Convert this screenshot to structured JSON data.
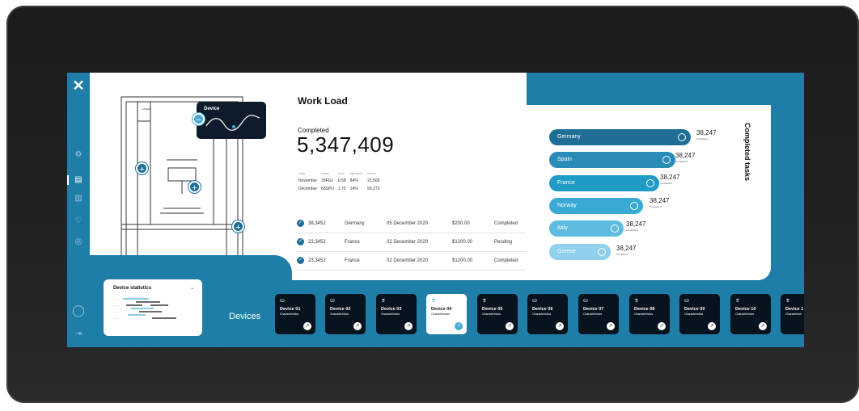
{
  "brand": {
    "logo_glyph": "✕"
  },
  "sidebar": {
    "icons": [
      "gear-icon",
      "layout-icon",
      "chart-icon",
      "heart-icon",
      "pin-icon"
    ],
    "bottom_icons": [
      "fingerprint-icon",
      "logout-icon"
    ]
  },
  "device_popup": {
    "label": "Device"
  },
  "workload": {
    "title": "Work Load",
    "completed_label": "Completed",
    "completed_value": "5,347,409",
    "mini_table": {
      "headers": [
        "TIME",
        "CODE",
        "UNIT",
        "PERCENT",
        "TOTAL"
      ],
      "rows": [
        [
          "November",
          "39FGI",
          "0.58",
          "84%",
          "21,568"
        ],
        [
          "December",
          "68SPU",
          "1.70",
          "14%",
          "56,273"
        ]
      ]
    },
    "rows": [
      {
        "id": "38,3452",
        "country": "Germany",
        "date": "05 December 2020",
        "amount": "$200.00",
        "status": "Completed"
      },
      {
        "id": "23,3452",
        "country": "France",
        "date": "02 December 2020",
        "amount": "$1200.00",
        "status": "Pending"
      },
      {
        "id": "23,3452",
        "country": "France",
        "date": "02 December 2020",
        "amount": "$1200.00",
        "status": "Completed"
      }
    ]
  },
  "completed_tasks": {
    "title": "Completed tasks",
    "bars": [
      {
        "country": "Germany",
        "value": "38,247",
        "sub": "Completed",
        "color": "#1f6e96"
      },
      {
        "country": "Spain",
        "value": "38,247",
        "sub": "Completed",
        "color": "#2a8bb8"
      },
      {
        "country": "France",
        "value": "38,247",
        "sub": "Completed",
        "color": "#1f9cc6"
      },
      {
        "country": "Norway",
        "value": "38,247",
        "sub": "Completed",
        "color": "#39aad3"
      },
      {
        "country": "Italy",
        "value": "38,247",
        "sub": "Completed",
        "color": "#5ebbe0"
      },
      {
        "country": "Greece",
        "value": "38,247",
        "sub": "Completed",
        "color": "#8fd0ec"
      }
    ]
  },
  "stats_card": {
    "title": "Device statistics"
  },
  "devices": {
    "label": "Devices",
    "items": [
      {
        "name": "Device 01",
        "sub": "Characteristics",
        "icon": "⛀",
        "active": false
      },
      {
        "name": "Device 02",
        "sub": "Characteristics",
        "icon": "⛀",
        "active": false
      },
      {
        "name": "Device 03",
        "sub": "Characteristics",
        "icon": "⌆",
        "active": false
      },
      {
        "name": "Device 04",
        "sub": "Characteristics",
        "icon": "⌆",
        "active": true
      },
      {
        "name": "Device 05",
        "sub": "Characteristics",
        "icon": "⌆",
        "active": false
      },
      {
        "name": "Device 06",
        "sub": "Characteristics",
        "icon": "⛀",
        "active": false
      },
      {
        "name": "Device 07",
        "sub": "Characteristics",
        "icon": "⛀",
        "active": false
      },
      {
        "name": "Device 08",
        "sub": "Characteristics",
        "icon": "⌆",
        "active": false
      },
      {
        "name": "Device 09",
        "sub": "Characteristics",
        "icon": "⛀",
        "active": false
      },
      {
        "name": "Device 10",
        "sub": "Characteristics",
        "icon": "⌆",
        "active": false
      },
      {
        "name": "Device 1",
        "sub": "Characteristi",
        "icon": "⌆",
        "active": false
      }
    ]
  }
}
